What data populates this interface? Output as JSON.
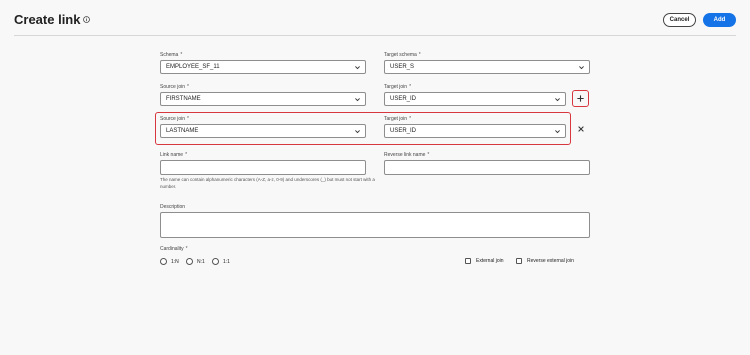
{
  "header": {
    "title": "Create link",
    "cancel_label": "Cancel",
    "add_label": "Add"
  },
  "form": {
    "schema": {
      "label": "Schema",
      "value": "EMPLOYEE_SF_11"
    },
    "target_schema": {
      "label": "Target schema",
      "value": "USER_S"
    },
    "join1": {
      "source_label": "Source join",
      "source_value": "FIRSTNAME",
      "target_label": "Target join",
      "target_value": "USER_ID"
    },
    "join2": {
      "source_label": "Source join",
      "source_value": "LASTNAME",
      "target_label": "Target join",
      "target_value": "USER_ID"
    },
    "link_name": {
      "label": "Link name",
      "value": "",
      "help": "The name can contain alphanumeric characters (A-Z, a-z, 0-9) and underscores (_) but must not start with a number."
    },
    "reverse_link_name": {
      "label": "Reverse link name",
      "value": ""
    },
    "description": {
      "label": "Description",
      "value": ""
    },
    "cardinality": {
      "label": "Cardinality",
      "options": [
        "1:N",
        "N:1",
        "1:1"
      ]
    },
    "external_join_label": "External join",
    "reverse_external_join_label": "Reverse external join",
    "required_marker": "*"
  },
  "colors": {
    "accent": "#1473e6",
    "highlight": "#d7373f",
    "background": "#f8f8f8"
  }
}
